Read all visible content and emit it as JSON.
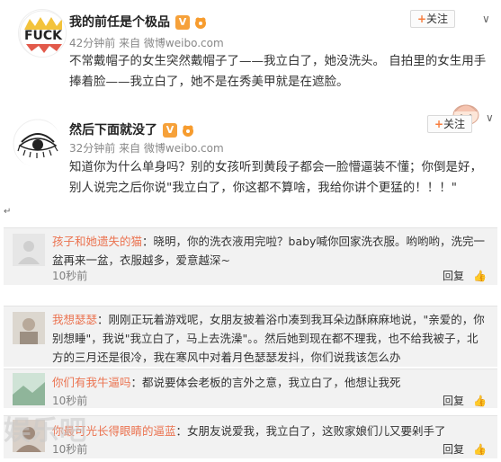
{
  "post1": {
    "username": "我的前任是个极品",
    "v_badge": "V",
    "avatar_text": "FUCK",
    "follow_label": "关注",
    "time": "42分钟前",
    "source": "来自 微博weibo.com",
    "content": "不常戴帽子的女生突然戴帽子了——我立白了，她没洗头。 自拍里的女生用手捧着脸——我立白了，她不是在秀美甲就是在遮脸。"
  },
  "post2": {
    "username": "然后下面就没了",
    "v_badge": "V",
    "follow_label": "关注",
    "time": "32分钟前",
    "source": "来自 微博weibo.com",
    "content": "知道你为什么单身吗？别的女孩听到黄段子都会一脸懵逼装不懂；你倒是好，别人说完之后你说\"我立白了，你这都不算啥，我给你讲个更猛的！！！\""
  },
  "comments": [
    {
      "user": "孩子和她遗失的猫",
      "text": "：晓明，你的洗衣液用完啦？baby喊你回家洗衣服。哟哟哟，洗完一盆再来一盆，衣服越多，爱意越深~",
      "time": "10秒前",
      "reply": "回复",
      "likes": "👍"
    },
    {
      "user": "我想瑟瑟",
      "text": "：刚刚正玩着游戏呢，女朋友披着浴巾凑到我耳朵边酥麻麻地说，\"亲爱的，你别想睡\"，我说\"我立白了，马上去洗澡\"。。然后她到现在都不理我，也不给我被子，北方的三月还是很冷，我在寒风中对着月色瑟瑟发抖，你们说我该怎么办",
      "time": "",
      "reply": "回复",
      "likes": "👍"
    },
    {
      "user": "你们有我牛逼吗",
      "text": "：都说要体会老板的言外之意，我立白了，他想让我死",
      "time": "10秒前",
      "reply": "回复",
      "likes": "👍"
    },
    {
      "user": "你最可光长得眼睛的逼蓝",
      "text": "：女朋友说爱我，我立白了，这败家娘们儿又要剁手了",
      "time": "10秒前",
      "reply": "回复",
      "likes": "👍"
    }
  ],
  "watermark": "娱乐吧",
  "corner_mark": "↵"
}
